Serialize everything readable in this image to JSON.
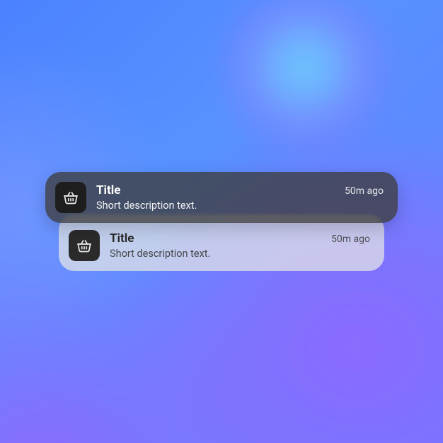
{
  "notifications": [
    {
      "variant": "dark",
      "icon": "basket-icon",
      "title": "Title",
      "description": "Short description text.",
      "time": "50m ago"
    },
    {
      "variant": "light",
      "icon": "basket-icon",
      "title": "Title",
      "description": "Short description text.",
      "time": "50m ago"
    }
  ]
}
